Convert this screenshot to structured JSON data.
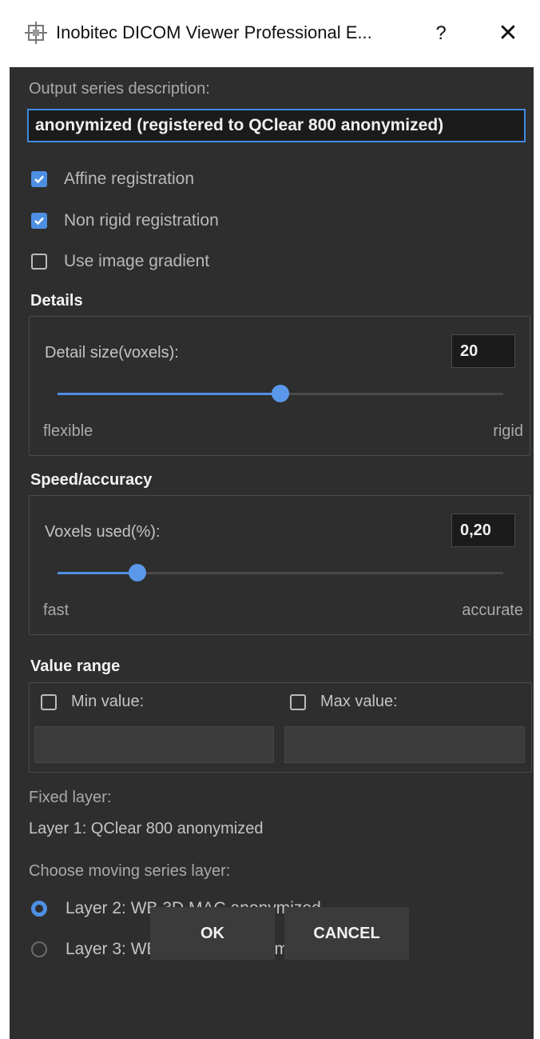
{
  "window": {
    "title": "Inobitec DICOM Viewer Professional E...",
    "help_label": "?",
    "close_label": "✕",
    "app_icon": "inobitec-app-icon"
  },
  "output": {
    "label": "Output series description:",
    "value": "anonymized (registered to QClear 800 anonymized)"
  },
  "options": {
    "affine": {
      "label": "Affine registration",
      "checked": true
    },
    "non_rigid": {
      "label": "Non rigid registration",
      "checked": true
    },
    "gradient": {
      "label": "Use image gradient",
      "checked": false
    }
  },
  "details": {
    "title": "Details",
    "field_label": "Detail size(voxels):",
    "value": "20",
    "slider_fraction": 0.5,
    "min_label": "flexible",
    "max_label": "rigid"
  },
  "speed": {
    "title": "Speed/accuracy",
    "field_label": "Voxels used(%):",
    "value": "0,20",
    "slider_fraction": 0.18,
    "min_label": "fast",
    "max_label": "accurate"
  },
  "value_range": {
    "title": "Value range",
    "min_label": "Min value:",
    "min_checked": false,
    "max_label": "Max value:",
    "max_checked": false
  },
  "fixed_layer": {
    "label": "Fixed layer:",
    "value": "Layer 1: QClear 800 anonymized"
  },
  "moving": {
    "label": "Choose moving series layer:",
    "options": [
      {
        "label": "Layer 2: WB 3D MAC anonymized",
        "selected": true
      },
      {
        "label": "Layer 3: WB 3D NAC anonymized",
        "selected": false
      }
    ]
  },
  "buttons": {
    "ok": "OK",
    "cancel": "CANCEL"
  },
  "colors": {
    "accent": "#4e8fe3",
    "background": "#2e2e2e",
    "input_background": "#1b1b1b"
  }
}
